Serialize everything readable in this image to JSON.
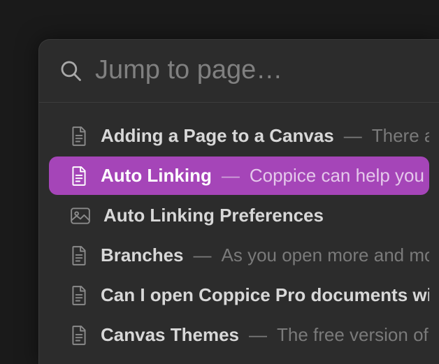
{
  "search": {
    "placeholder": "Jump to page…",
    "value": ""
  },
  "results": [
    {
      "icon": "page",
      "title": "Adding a Page to a Canvas",
      "description": "There are",
      "selected": false
    },
    {
      "icon": "page",
      "title": "Auto Linking",
      "description": "Coppice can help you co",
      "selected": true
    },
    {
      "icon": "image",
      "title": "Auto Linking Preferences",
      "description": "",
      "selected": false
    },
    {
      "icon": "page",
      "title": "Branches",
      "description": "As you open more and more",
      "selected": false
    },
    {
      "icon": "page",
      "title": "Can I open Coppice Pro documents witho",
      "description": "",
      "selected": false
    },
    {
      "icon": "page",
      "title": "Canvas Themes",
      "description": "The free version of C",
      "selected": false
    }
  ],
  "colors": {
    "selection": "#a545b8"
  }
}
